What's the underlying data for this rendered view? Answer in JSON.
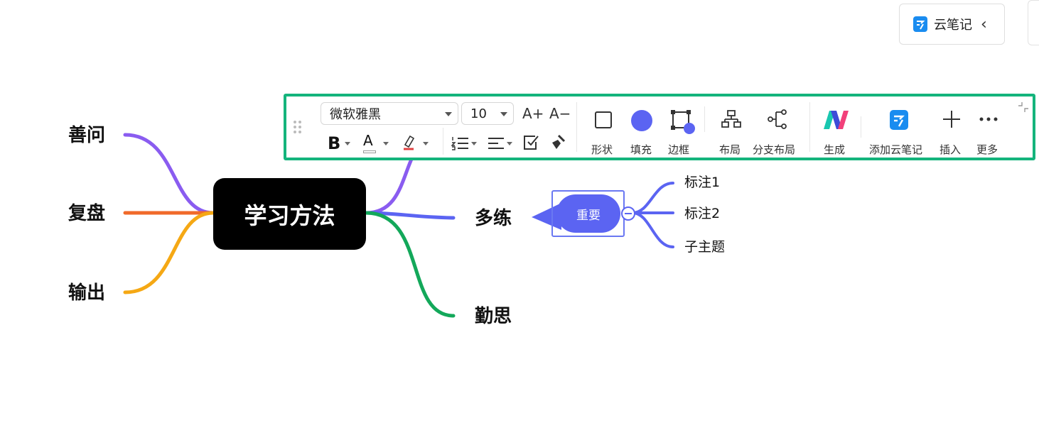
{
  "mindmap": {
    "root": "学习方法",
    "left_branches": [
      {
        "label": "善问",
        "color": "#8a5cf0"
      },
      {
        "label": "复盘",
        "color": "#f06a2a"
      },
      {
        "label": "输出",
        "color": "#f5a814"
      }
    ],
    "right_branches": [
      {
        "label": "多练",
        "color": "#5b64f2"
      },
      {
        "label": "勤思",
        "color": "#13a85a"
      }
    ],
    "hidden_branch_color": "#8a5cf0",
    "selected_node": "重要",
    "sub_topics": [
      "标注1",
      "标注2",
      "子主题"
    ],
    "sub_color": "#5b64f2"
  },
  "cloud_note": {
    "label": "云笔记",
    "chevron": "‹"
  },
  "toolbar": {
    "border_color": "#14b47c",
    "font_family_value": "微软雅黑",
    "font_size_value": "10",
    "increase_font": "A+",
    "decrease_font": "A−",
    "tools": {
      "shape": "形状",
      "fill": "填充",
      "border": "边框",
      "layout": "布局",
      "branch_layout": "分支布局",
      "generate": "生成",
      "add_cloud_note": "添加云笔记",
      "insert": "插入",
      "more": "更多"
    },
    "fill_color": "#5b64f2"
  }
}
